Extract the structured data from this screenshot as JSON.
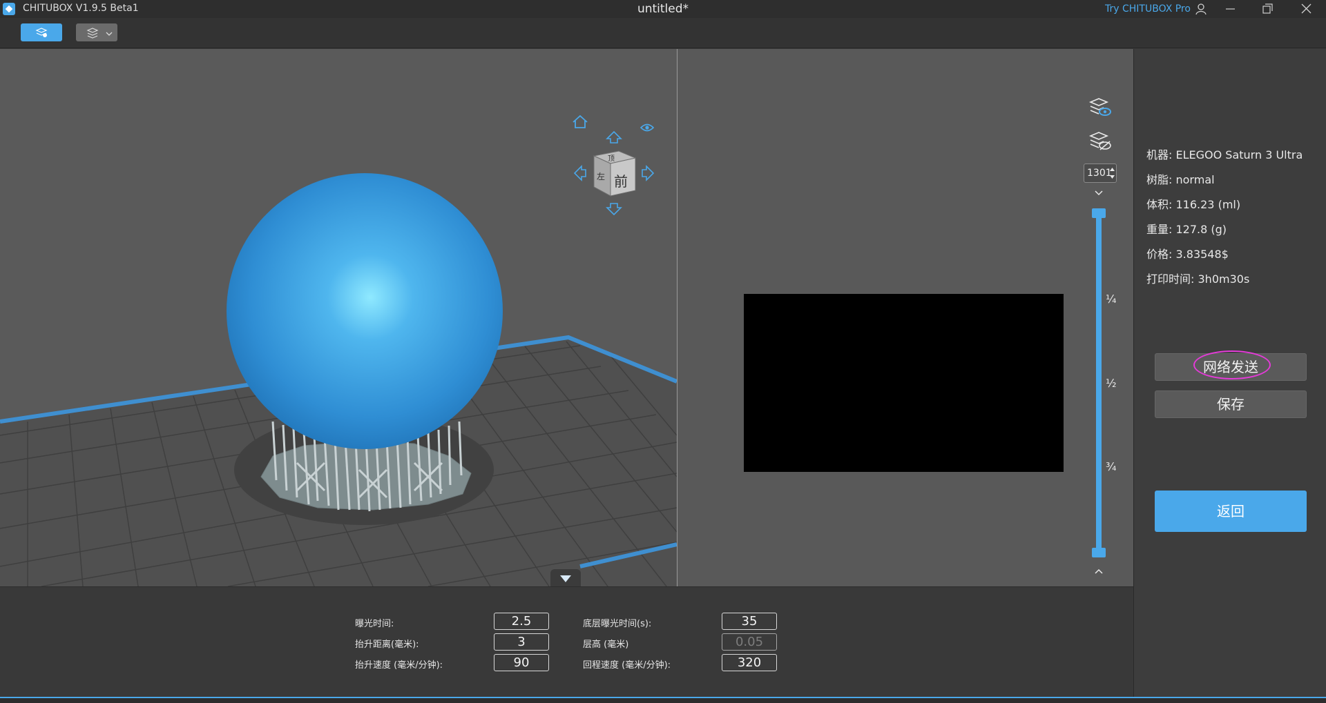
{
  "titlebar": {
    "app_name": "CHITUBOX V1.9.5 Beta1",
    "document": "untitled*",
    "pro_link": "Try CHITUBOX Pro"
  },
  "view_cube": {
    "face_front": "前",
    "face_left": "左",
    "face_top": "顶"
  },
  "slider": {
    "layer_value": "1301",
    "ticks": [
      "¼",
      "½",
      "¾"
    ]
  },
  "info": {
    "machine_label": "机器:",
    "machine_value": "ELEGOO Saturn 3 Ultra",
    "resin_label": "树脂:",
    "resin_value": "normal",
    "volume_label": "体积:",
    "volume_value": "116.23  (ml)",
    "weight_label": "重量:",
    "weight_value": "127.8  (g)",
    "price_label": "价格:",
    "price_value": "3.83548$",
    "time_label": "打印时间:",
    "time_value": "3h0m30s"
  },
  "buttons": {
    "network_send": "网络发送",
    "save": "保存",
    "back": "返回"
  },
  "params": {
    "exposure_label": "曝光时间:",
    "exposure_value": "2.5",
    "lift_dist_label": "抬升距离(毫米):",
    "lift_dist_value": "3",
    "lift_speed_label": "抬升速度 (毫米/分钟):",
    "lift_speed_value": "90",
    "bottom_exposure_label": "底层曝光时间(s):",
    "bottom_exposure_value": "35",
    "layer_height_label": "层高 (毫米)",
    "layer_height_value": "0.05",
    "retract_speed_label": "回程速度 (毫米/分钟):",
    "retract_speed_value": "320"
  },
  "colors": {
    "accent": "#4aa8ea",
    "highlight": "#e43bd8",
    "model": "#3a93d6"
  }
}
